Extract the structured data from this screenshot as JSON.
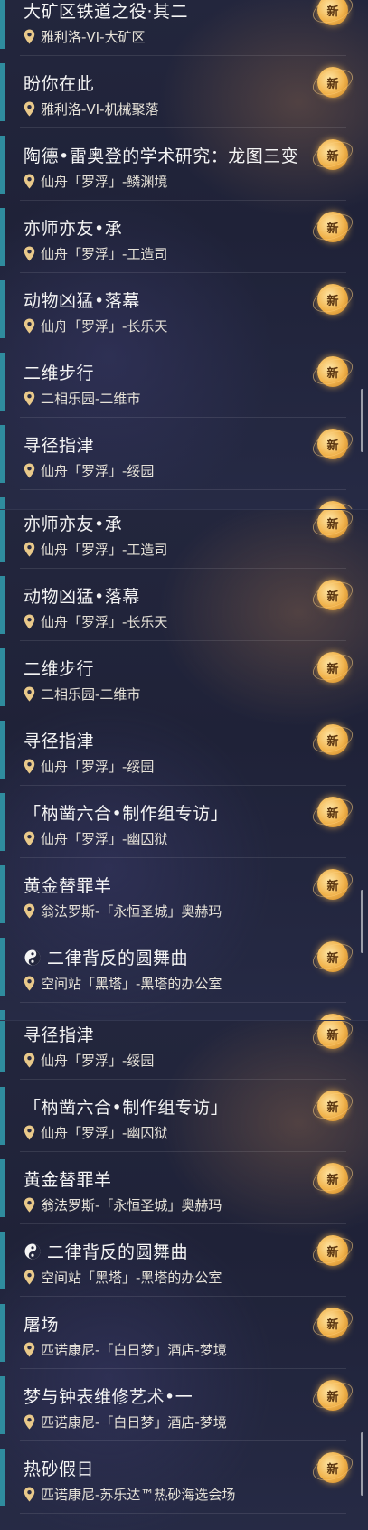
{
  "badge_label": "新",
  "panels": [
    {
      "items": [
        {
          "title": "大矿区铁道之役·其二",
          "location": "雅利洛-VI-大矿区"
        },
        {
          "title": "盼你在此",
          "location": "雅利洛-VI-机械聚落"
        },
        {
          "title": "陶德•雷奥登的学术研究：龙图三变",
          "location": "仙舟「罗浮」-鳞渊境"
        },
        {
          "title": "亦师亦友•承",
          "location": "仙舟「罗浮」-工造司"
        },
        {
          "title": "动物凶猛•落幕",
          "location": "仙舟「罗浮」-长乐天"
        },
        {
          "title": "二维步行",
          "location": "二相乐园-二维市"
        },
        {
          "title": "寻径指津",
          "location": "仙舟「罗浮」-绥园"
        },
        {
          "title": "「枘凿六合•制作组专访」",
          "location": "仙舟「罗浮」-幽囚狱"
        }
      ]
    },
    {
      "items": [
        {
          "title": "亦师亦友•承",
          "location": "仙舟「罗浮」-工造司"
        },
        {
          "title": "动物凶猛•落幕",
          "location": "仙舟「罗浮」-长乐天"
        },
        {
          "title": "二维步行",
          "location": "二相乐园-二维市"
        },
        {
          "title": "寻径指津",
          "location": "仙舟「罗浮」-绥园"
        },
        {
          "title": "「枘凿六合•制作组专访」",
          "location": "仙舟「罗浮」-幽囚狱"
        },
        {
          "title": "黄金替罪羊",
          "location": "翁法罗斯-「永恒圣城」奥赫玛"
        },
        {
          "title": "二律背反的圆舞曲",
          "location": "空间站「黑塔」-黑塔的办公室",
          "icon": true
        },
        {
          "title": "屠场",
          "location": "匹诺康尼-「白日梦」酒店-梦境"
        }
      ]
    },
    {
      "items": [
        {
          "title": "寻径指津",
          "location": "仙舟「罗浮」-绥园"
        },
        {
          "title": "「枘凿六合•制作组专访」",
          "location": "仙舟「罗浮」-幽囚狱"
        },
        {
          "title": "黄金替罪羊",
          "location": "翁法罗斯-「永恒圣城」奥赫玛"
        },
        {
          "title": "二律背反的圆舞曲",
          "location": "空间站「黑塔」-黑塔的办公室",
          "icon": true
        },
        {
          "title": "屠场",
          "location": "匹诺康尼-「白日梦」酒店-梦境"
        },
        {
          "title": "梦与钟表维修艺术•一",
          "location": "匹诺康尼-「白日梦」酒店-梦境"
        },
        {
          "title": "热砂假日",
          "location": "匹诺康尼-苏乐达™热砂海选会场"
        }
      ]
    }
  ]
}
